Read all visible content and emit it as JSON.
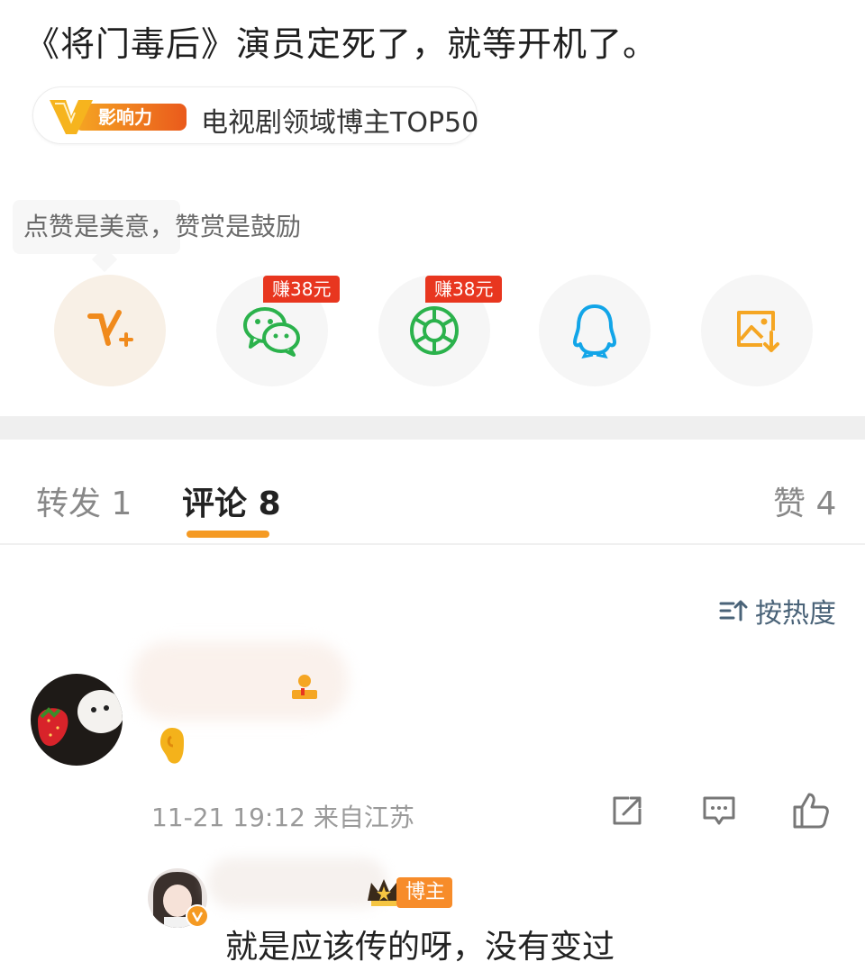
{
  "post": {
    "text": "《将门毒后》演员定死了，就等开机了。",
    "influence_badge": {
      "logo_text": "影响力",
      "label": "电视剧领域博主TOP50"
    }
  },
  "reward": {
    "tooltip": "点赞是美意，赞赏是鼓励",
    "share_targets": [
      {
        "name": "v-plus-icon",
        "earn": ""
      },
      {
        "name": "wechat-icon",
        "earn": "赚38元"
      },
      {
        "name": "moments-icon",
        "earn": "赚38元"
      },
      {
        "name": "qq-icon",
        "earn": ""
      },
      {
        "name": "save-image-icon",
        "earn": ""
      }
    ]
  },
  "tabs": [
    {
      "label": "转发",
      "count": "1"
    },
    {
      "label": "评论",
      "count": "8"
    },
    {
      "label": "赞",
      "count": "4"
    }
  ],
  "sort": {
    "label": "按热度",
    "icon": "sort-icon"
  },
  "comment": {
    "meta": "11-21 19:12 来自江苏",
    "actions": [
      "share-icon",
      "comment-icon",
      "like-icon"
    ],
    "reply": {
      "badge": "博主",
      "text": "就是应该传的呀，没有变过"
    }
  },
  "colors": {
    "accent": "#f59a23",
    "earn_red": "#e8361f",
    "wechat_green": "#2bb24c",
    "qq_blue": "#12a5e8",
    "sort_blue": "#4a6378"
  }
}
